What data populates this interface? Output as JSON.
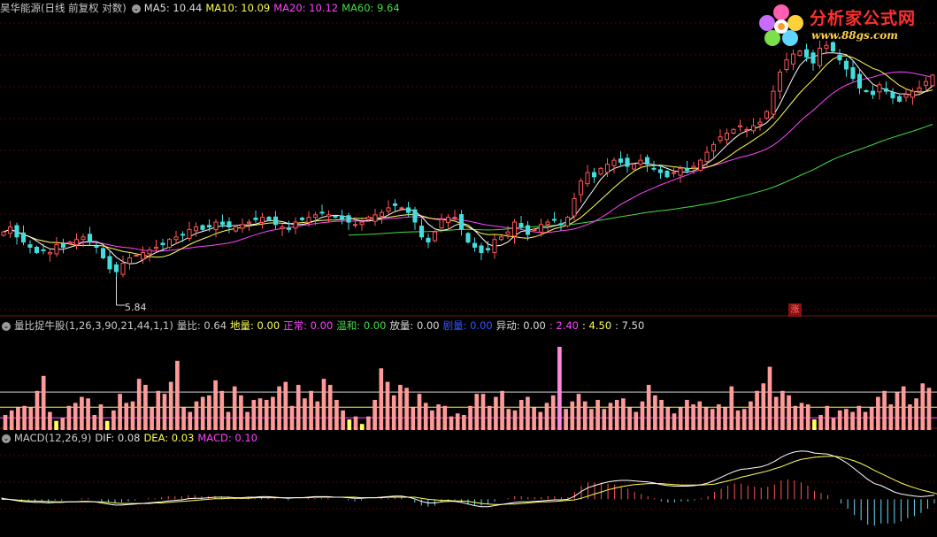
{
  "main": {
    "stock": "昊华能源(日线 前复权 对数)",
    "circle": "⌄",
    "ma5": "MA5: 10.44",
    "ma10": "MA10: 10.09",
    "ma20": "MA20: 10.12",
    "ma60": "MA60: 9.64",
    "low_label": "5.84",
    "zhang": "涨"
  },
  "vol": {
    "title": "量比捉牛股(1,26,3,90,21,44,1,1)",
    "ratio": "量比: 0.64",
    "diliang": "地量: 0.00",
    "zhengchang": "正常: 0.00",
    "wenhe": "温和: 0.00",
    "fangliang": "放量: 0.00",
    "juliang": "剧量: 0.00",
    "yidong": "异动: 0.00",
    "v1": ": 2.40",
    "v2": ": 4.50",
    "v3": ": 7.50"
  },
  "macd": {
    "title": "MACD(12,26,9)",
    "dif": "DIF: 0.08",
    "dea": "DEA: 0.03",
    "macd": "MACD: 0.10"
  },
  "watermark": {
    "title": "分析家公式网",
    "url": "www.88gs.com"
  },
  "colors": {
    "up": "#ff5555",
    "down": "#44dddd",
    "ma5": "#ffffff",
    "ma10": "#ffff55",
    "ma20": "#ff44ff",
    "ma60": "#44dd44",
    "vol_bar": "#ff9a9a",
    "vol_low": "#ffff66",
    "vol_spike": "#ff88dd"
  },
  "chart_data": [
    {
      "type": "candlestick",
      "title": "昊华能源(日线 前复权 对数)",
      "series": [
        {
          "name": "MA5",
          "last": 10.44
        },
        {
          "name": "MA10",
          "last": 10.09
        },
        {
          "name": "MA20",
          "last": 10.12
        },
        {
          "name": "MA60",
          "last": 9.64
        }
      ],
      "annotations": [
        "5.84"
      ],
      "scale": "log",
      "ylim": [
        5.6,
        11.8
      ],
      "close": [
        6.7,
        6.8,
        6.6,
        6.5,
        6.4,
        6.3,
        6.35,
        6.3,
        6.45,
        6.4,
        6.5,
        6.55,
        6.6,
        6.5,
        6.4,
        6.2,
        6.0,
        5.95,
        6.1,
        6.2,
        6.25,
        6.3,
        6.35,
        6.4,
        6.45,
        6.55,
        6.6,
        6.65,
        6.75,
        6.8,
        6.75,
        6.8,
        6.9,
        6.85,
        6.8,
        6.8,
        6.85,
        6.9,
        6.95,
        7.0,
        6.95,
        6.85,
        6.8,
        6.75,
        6.9,
        6.95,
        7.0,
        7.05,
        7.1,
        7.05,
        7.0,
        6.95,
        6.9,
        6.85,
        6.9,
        7.0,
        7.05,
        7.1,
        7.2,
        7.25,
        7.2,
        7.1,
        6.9,
        6.6,
        6.5,
        6.7,
        6.95,
        7.0,
        7.0,
        6.75,
        6.5,
        6.4,
        6.3,
        6.35,
        6.55,
        6.6,
        6.7,
        6.9,
        6.8,
        6.65,
        6.75,
        6.85,
        6.9,
        6.95,
        6.85,
        7.0,
        7.4,
        7.8,
        8.0,
        7.9,
        8.1,
        8.2,
        8.3,
        8.25,
        8.15,
        8.2,
        8.3,
        8.2,
        8.1,
        8.0,
        7.9,
        8.0,
        8.1,
        8.05,
        8.15,
        8.3,
        8.5,
        8.7,
        8.9,
        9.0,
        9.1,
        9.2,
        9.1,
        9.2,
        9.3,
        9.6,
        10.2,
        10.8,
        11.2,
        11.4,
        11.5,
        11.3,
        11.1,
        11.6,
        11.7,
        11.5,
        11.2,
        10.9,
        10.6,
        10.3,
        10.2,
        10.1,
        10.4,
        10.2,
        10.0,
        9.9,
        10.1,
        10.2,
        10.3,
        10.5,
        10.7
      ]
    },
    {
      "type": "bar",
      "title": "量比捉牛股(1,26,3,90,21,44,1,1)",
      "series": [
        {
          "name": "量比",
          "last": 0.64
        },
        {
          "name": "地量",
          "last": 0.0
        },
        {
          "name": "正常",
          "last": 0.0
        },
        {
          "name": "温和",
          "last": 0.0
        },
        {
          "name": "放量",
          "last": 0.0
        },
        {
          "name": "剧量",
          "last": 0.0
        },
        {
          "name": "异动",
          "last": 0.0
        }
      ],
      "thresholds": [
        2.4,
        4.5,
        7.5
      ],
      "values": [
        1.0,
        1.3,
        1.5,
        1.6,
        1.5,
        2.6,
        3.6,
        1.2,
        0.6,
        0.8,
        1.6,
        1.8,
        2.2,
        2.1,
        1.0,
        1.7,
        0.6,
        1.3,
        2.4,
        1.8,
        1.9,
        3.4,
        3.0,
        1.5,
        2.6,
        2.4,
        3.2,
        4.6,
        1.5,
        1.2,
        1.9,
        2.2,
        2.3,
        3.3,
        2.6,
        1.2,
        2.9,
        2.3,
        1.2,
        2.0,
        2.1,
        2.0,
        2.2,
        2.9,
        3.2,
        1.6,
        3.0,
        2.1,
        2.6,
        1.9,
        3.4,
        3.0,
        2.0,
        1.3,
        0.7,
        0.9,
        0.4,
        0.9,
        2.0,
        4.1,
        3.2,
        2.3,
        3.0,
        2.8,
        1.5,
        2.4,
        1.8,
        1.3,
        1.7,
        1.6,
        0.9,
        1.1,
        1.0,
        1.6,
        2.4,
        2.4,
        1.6,
        2.2,
        2.6,
        1.4,
        1.3,
        2.0,
        2.2,
        1.5,
        1.2,
        1.8,
        2.3,
        10.0,
        1.4,
        1.9,
        2.4,
        1.9,
        1.4,
        2.0,
        1.4,
        1.8,
        2.0,
        2.1,
        1.5,
        1.2,
        1.9,
        3.0,
        2.3,
        2.0,
        1.5,
        1.1,
        1.5,
        2.0,
        1.7,
        1.9,
        1.5,
        1.4,
        1.7,
        1.5,
        2.9,
        1.3,
        1.4,
        1.9,
        2.6,
        3.1,
        4.2,
        2.2,
        2.6,
        2.3,
        1.6,
        1.8,
        1.7,
        0.7,
        1.0,
        1.6,
        0.8,
        1.3,
        1.4,
        1.2,
        1.6,
        1.2,
        1.5,
        2.2,
        2.6,
        1.7,
        2.5,
        2.9,
        1.7,
        2.1,
        3.1,
        2.8
      ]
    },
    {
      "type": "bar",
      "title": "MACD(12,26,9)",
      "series": [
        {
          "name": "DIF",
          "last": 0.08
        },
        {
          "name": "DEA",
          "last": 0.03
        },
        {
          "name": "MACD",
          "last": 0.1
        }
      ],
      "ylim": [
        -0.6,
        1.0
      ],
      "dif": [
        0.02,
        0.0,
        -0.02,
        -0.04,
        -0.05,
        -0.06,
        -0.06,
        -0.07,
        -0.06,
        -0.06,
        -0.05,
        -0.05,
        -0.04,
        -0.04,
        -0.05,
        -0.07,
        -0.09,
        -0.11,
        -0.11,
        -0.1,
        -0.09,
        -0.08,
        -0.07,
        -0.06,
        -0.05,
        -0.03,
        -0.02,
        -0.01,
        0.01,
        0.02,
        0.02,
        0.03,
        0.04,
        0.04,
        0.04,
        0.03,
        0.03,
        0.04,
        0.04,
        0.05,
        0.05,
        0.04,
        0.03,
        0.02,
        0.03,
        0.03,
        0.04,
        0.05,
        0.05,
        0.05,
        0.04,
        0.04,
        0.03,
        0.02,
        0.02,
        0.03,
        0.03,
        0.04,
        0.05,
        0.06,
        0.06,
        0.04,
        0.01,
        -0.04,
        -0.07,
        -0.07,
        -0.05,
        -0.04,
        -0.04,
        -0.06,
        -0.09,
        -0.12,
        -0.14,
        -0.14,
        -0.12,
        -0.1,
        -0.08,
        -0.06,
        -0.05,
        -0.05,
        -0.04,
        -0.03,
        -0.02,
        -0.01,
        -0.01,
        0.0,
        0.06,
        0.15,
        0.22,
        0.26,
        0.3,
        0.33,
        0.35,
        0.36,
        0.36,
        0.35,
        0.34,
        0.33,
        0.31,
        0.28,
        0.26,
        0.25,
        0.25,
        0.25,
        0.26,
        0.28,
        0.31,
        0.36,
        0.42,
        0.48,
        0.53,
        0.57,
        0.58,
        0.6,
        0.62,
        0.66,
        0.72,
        0.8,
        0.86,
        0.9,
        0.92,
        0.91,
        0.88,
        0.87,
        0.86,
        0.82,
        0.76,
        0.68,
        0.58,
        0.48,
        0.38,
        0.3,
        0.26,
        0.2,
        0.14,
        0.1,
        0.08,
        0.06,
        0.05,
        0.06,
        0.08
      ],
      "dea": [
        0.0,
        0.0,
        -0.01,
        -0.02,
        -0.03,
        -0.03,
        -0.04,
        -0.04,
        -0.05,
        -0.05,
        -0.05,
        -0.05,
        -0.05,
        -0.05,
        -0.05,
        -0.05,
        -0.06,
        -0.07,
        -0.08,
        -0.08,
        -0.08,
        -0.08,
        -0.08,
        -0.07,
        -0.07,
        -0.06,
        -0.05,
        -0.04,
        -0.03,
        -0.02,
        -0.01,
        0.0,
        0.01,
        0.01,
        0.02,
        0.02,
        0.02,
        0.02,
        0.03,
        0.03,
        0.03,
        0.03,
        0.03,
        0.03,
        0.03,
        0.03,
        0.03,
        0.04,
        0.04,
        0.04,
        0.04,
        0.04,
        0.04,
        0.04,
        0.03,
        0.03,
        0.03,
        0.03,
        0.04,
        0.04,
        0.04,
        0.04,
        0.04,
        0.02,
        0.0,
        -0.01,
        -0.02,
        -0.02,
        -0.03,
        -0.03,
        -0.04,
        -0.06,
        -0.08,
        -0.09,
        -0.1,
        -0.1,
        -0.09,
        -0.09,
        -0.08,
        -0.07,
        -0.06,
        -0.05,
        -0.05,
        -0.04,
        -0.03,
        -0.02,
        -0.01,
        0.02,
        0.06,
        0.1,
        0.14,
        0.18,
        0.21,
        0.24,
        0.26,
        0.28,
        0.29,
        0.3,
        0.3,
        0.3,
        0.29,
        0.28,
        0.27,
        0.27,
        0.27,
        0.27,
        0.28,
        0.29,
        0.32,
        0.35,
        0.38,
        0.42,
        0.45,
        0.48,
        0.51,
        0.54,
        0.58,
        0.62,
        0.67,
        0.72,
        0.76,
        0.78,
        0.8,
        0.81,
        0.82,
        0.82,
        0.8,
        0.77,
        0.73,
        0.68,
        0.62,
        0.55,
        0.49,
        0.43,
        0.37,
        0.31,
        0.26,
        0.22,
        0.18,
        0.15,
        0.12,
        0.08
      ]
    }
  ]
}
